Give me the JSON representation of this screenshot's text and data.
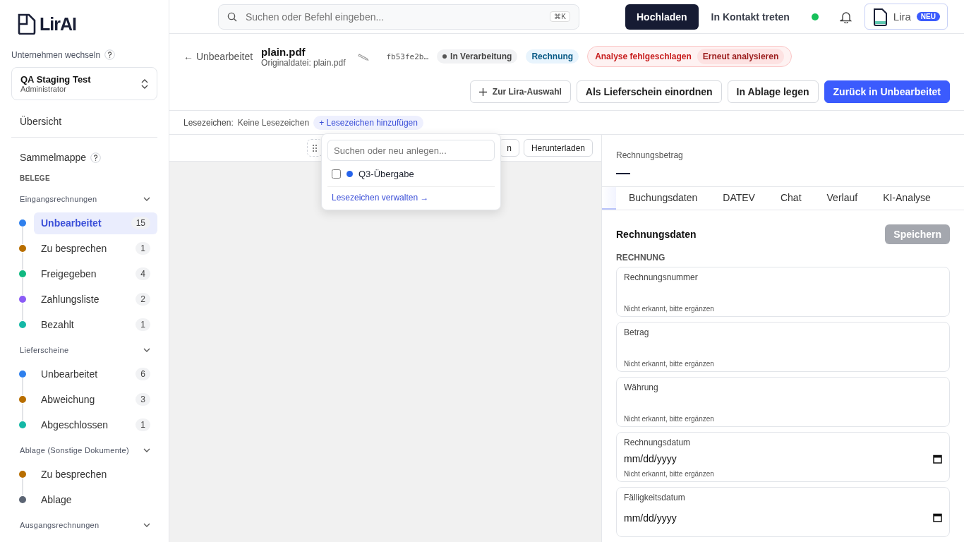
{
  "logo": {
    "text": "LirAI"
  },
  "sidebar": {
    "company_label": "Unternehmen wechseln",
    "company": {
      "name": "QA Staging Test",
      "role": "Administrator"
    },
    "overview": "Übersicht",
    "collection": "Sammelmappe",
    "section": "BELEGE",
    "groups": [
      {
        "name": "Eingangsrechnungen",
        "expanded": true,
        "items": [
          {
            "label": "Unbearbeitet",
            "count": "15",
            "color": "#2f80ed",
            "selected": true
          },
          {
            "label": "Zu besprechen",
            "count": "1",
            "color": "#b86e00",
            "selected": false
          },
          {
            "label": "Freigegeben",
            "count": "4",
            "color": "#10b981",
            "selected": false
          },
          {
            "label": "Zahlungsliste",
            "count": "2",
            "color": "#8b5cf6",
            "selected": false
          },
          {
            "label": "Bezahlt",
            "count": "1",
            "color": "#14b8a6",
            "selected": false
          }
        ]
      },
      {
        "name": "Lieferscheine",
        "expanded": true,
        "items": [
          {
            "label": "Unbearbeitet",
            "count": "6",
            "color": "#2f80ed",
            "selected": false
          },
          {
            "label": "Abweichung",
            "count": "3",
            "color": "#b86e00",
            "selected": false
          },
          {
            "label": "Abgeschlossen",
            "count": "1",
            "color": "#14b8a6",
            "selected": false
          }
        ]
      },
      {
        "name": "Ablage (Sonstige Dokumente)",
        "expanded": true,
        "items": [
          {
            "label": "Zu besprechen",
            "color": "#b86e00",
            "selected": false
          },
          {
            "label": "Ablage",
            "color": "#5b6473",
            "selected": false
          }
        ]
      },
      {
        "name": "Ausgangsrechnungen",
        "expanded": true
      }
    ]
  },
  "topbar": {
    "search": {
      "placeholder": "Suchen oder Befehl eingeben...",
      "shortcut": "⌘K"
    },
    "upload": "Hochladen",
    "contact": "In Kontakt treten",
    "online": true,
    "assistant": {
      "label": "Lira",
      "badge": "NEU"
    }
  },
  "document": {
    "back": "← Unbearbeitet",
    "title": "plain.pdf",
    "original": "Originaldatei: plain.pdf",
    "hash": "fb53fe2b…",
    "status": "In Verarbeitung",
    "type": "Rechnung",
    "error": "Analyse fehlgeschlagen",
    "retry": "Erneut analysieren",
    "actions": [
      {
        "label": "Zur Lira-Auswahl",
        "kind": "add"
      },
      {
        "label": "Als Lieferschein einordnen",
        "kind": "outline"
      },
      {
        "label": "In Ablage legen",
        "kind": "outline"
      },
      {
        "label": "Zurück in Unbearbeitet",
        "kind": "primary"
      }
    ]
  },
  "bookmarks": {
    "label": "Lesezeichen:",
    "empty": "Keine Lesezeichen",
    "add": "+ Lesezeichen hinzufügen",
    "popover": {
      "placeholder": "Suchen oder neu anlegen...",
      "items": [
        {
          "label": "Q3-Übergabe",
          "checked": false,
          "color": "#2563eb"
        }
      ],
      "manage": "Lesezeichen verwalten →"
    }
  },
  "viewer": {
    "buttons": [
      "n",
      "Herunterladen"
    ]
  },
  "panel": {
    "amount_label": "Rechnungsbetrag",
    "amount": "—",
    "tabs": [
      {
        "label": "Buchungsdaten",
        "selected": false
      },
      {
        "label": "DATEV",
        "selected": false
      },
      {
        "label": "Chat",
        "selected": false
      },
      {
        "label": "Verlauf",
        "selected": false
      },
      {
        "label": "KI-Analyse",
        "selected": false
      }
    ],
    "form_title": "Rechnungsdaten",
    "save": {
      "label": "Speichern",
      "disabled": true
    },
    "section": "RECHNUNG",
    "fields": [
      {
        "label": "Rechnungsnummer",
        "kind": "text",
        "hint": "Nicht erkannt, bitte ergänzen"
      },
      {
        "label": "Betrag",
        "kind": "text",
        "hint": "Nicht erkannt, bitte ergänzen"
      },
      {
        "label": "Währung",
        "kind": "text",
        "hint": "Nicht erkannt, bitte ergänzen"
      },
      {
        "label": "Rechnungsdatum",
        "kind": "date",
        "placeholder": "mm/dd/yyyy",
        "hint": "Nicht erkannt, bitte ergänzen"
      },
      {
        "label": "Fälligkeitsdatum",
        "kind": "date",
        "placeholder": "mm/dd/yyyy"
      }
    ]
  }
}
